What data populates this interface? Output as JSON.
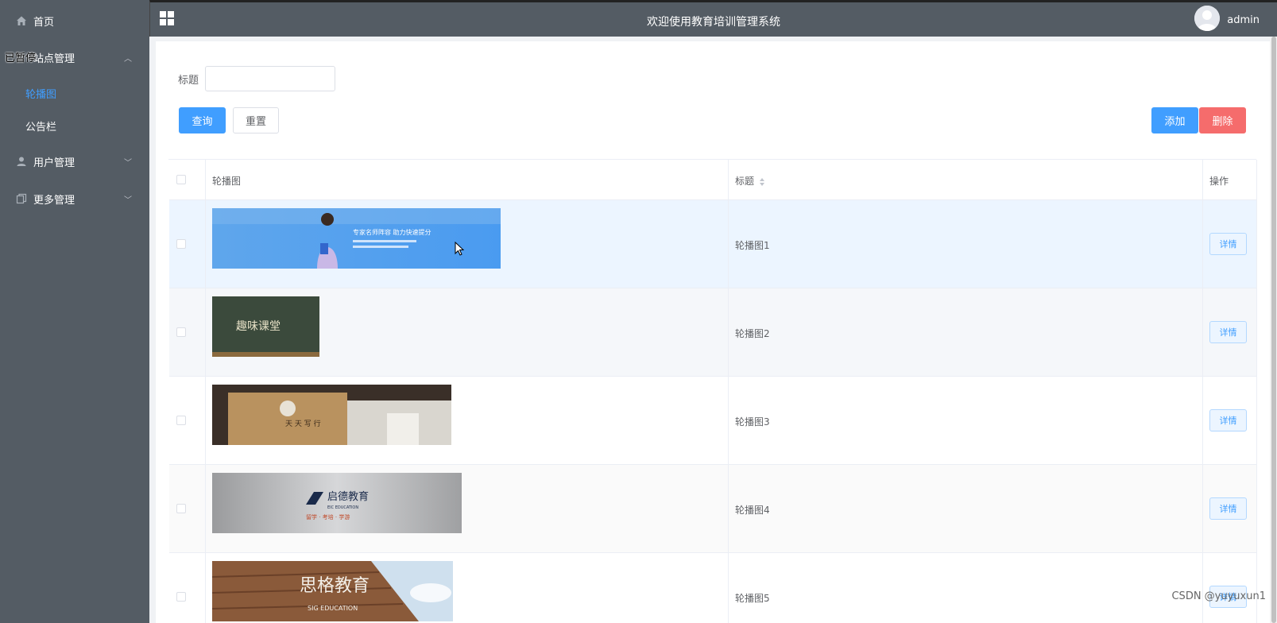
{
  "sidebar": {
    "home": "首页",
    "site_mgmt": "站点管理",
    "carousel": "轮播图",
    "notice": "公告栏",
    "user_mgmt": "用户管理",
    "more_mgmt": "更多管理",
    "overlay_status": "已暂停"
  },
  "header": {
    "title": "欢迎使用教育培训管理系统",
    "username": "admin"
  },
  "search": {
    "label": "标题",
    "value": "",
    "query_btn": "查询",
    "reset_btn": "重置",
    "add_btn": "添加",
    "delete_btn": "删除"
  },
  "table": {
    "col_image": "轮播图",
    "col_title": "标题",
    "col_actions": "操作",
    "rows": [
      {
        "title": "轮播图1",
        "action": "详情",
        "img_text": "专家名师阵容  助力快速提分"
      },
      {
        "title": "轮播图2",
        "action": "详情",
        "img_text": "趣味课堂"
      },
      {
        "title": "轮播图3",
        "action": "详情",
        "img_text": "天 天 写 行"
      },
      {
        "title": "轮播图4",
        "action": "详情",
        "img_text": "启德教育",
        "img_sub": "EIC EDUCATION",
        "img_tag": "留学 · 考培 · 学游"
      },
      {
        "title": "轮播图5",
        "action": "详情",
        "img_text": "思格教育",
        "img_sub": "SIG EDUCATION"
      }
    ]
  },
  "watermark": "CSDN @yuyuxun1",
  "colors": {
    "sidebar": "#545c64",
    "primary": "#409eff",
    "danger": "#f56c6c"
  }
}
